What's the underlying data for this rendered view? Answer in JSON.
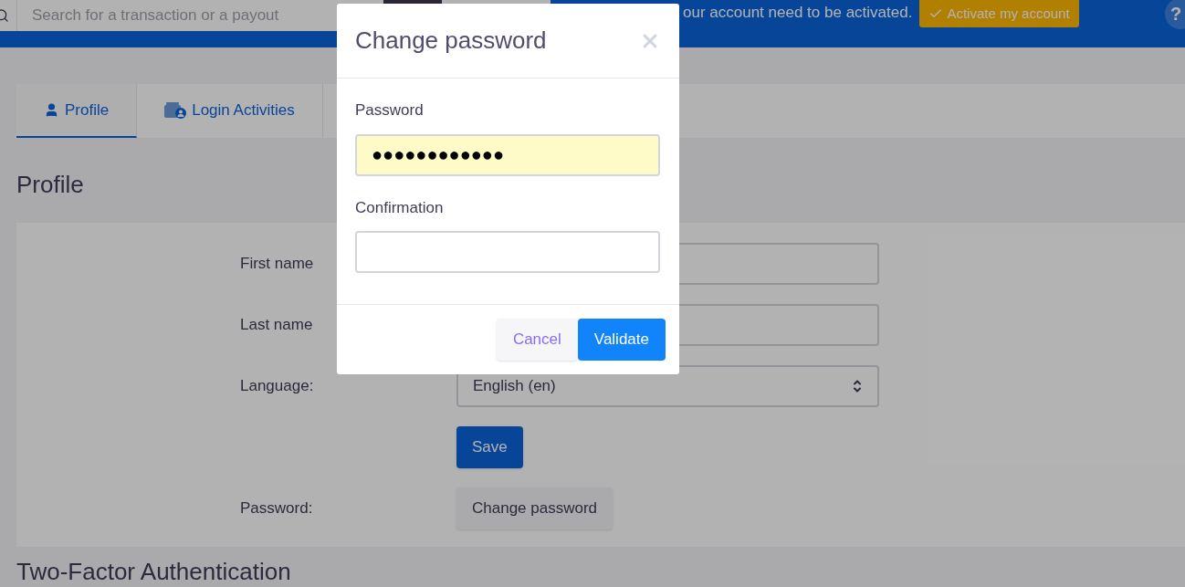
{
  "topbar": {
    "search_placeholder": "Search for a transaction or a payout",
    "notice": "our account need to be activated.",
    "activate_button": "Activate my account",
    "help": "?"
  },
  "tabs": [
    {
      "label": "Profile",
      "kind": "user",
      "selected": true
    },
    {
      "label": "Login Activities",
      "kind": "activity",
      "selected": false
    }
  ],
  "profile": {
    "title": "Profile",
    "fields": [
      {
        "label": "First name",
        "kind": "input"
      },
      {
        "label": "Last name",
        "kind": "input"
      },
      {
        "label": "Language:",
        "kind": "select",
        "value": "English (en)"
      },
      {
        "kind": "save",
        "value": "Save"
      },
      {
        "label": "Password:",
        "kind": "button",
        "value": "Change password"
      }
    ]
  },
  "next_section_title": "Two-Factor Authentication",
  "modal": {
    "title": "Change password",
    "fields": [
      {
        "label": "Password",
        "value": "●●●●●●●●●●●●",
        "autofilled": true
      },
      {
        "label": "Confirmation",
        "autofilled": false
      }
    ],
    "buttons": [
      {
        "label": "Cancel",
        "kind": "secondary"
      },
      {
        "label": "Validate",
        "kind": "primary"
      }
    ]
  }
}
